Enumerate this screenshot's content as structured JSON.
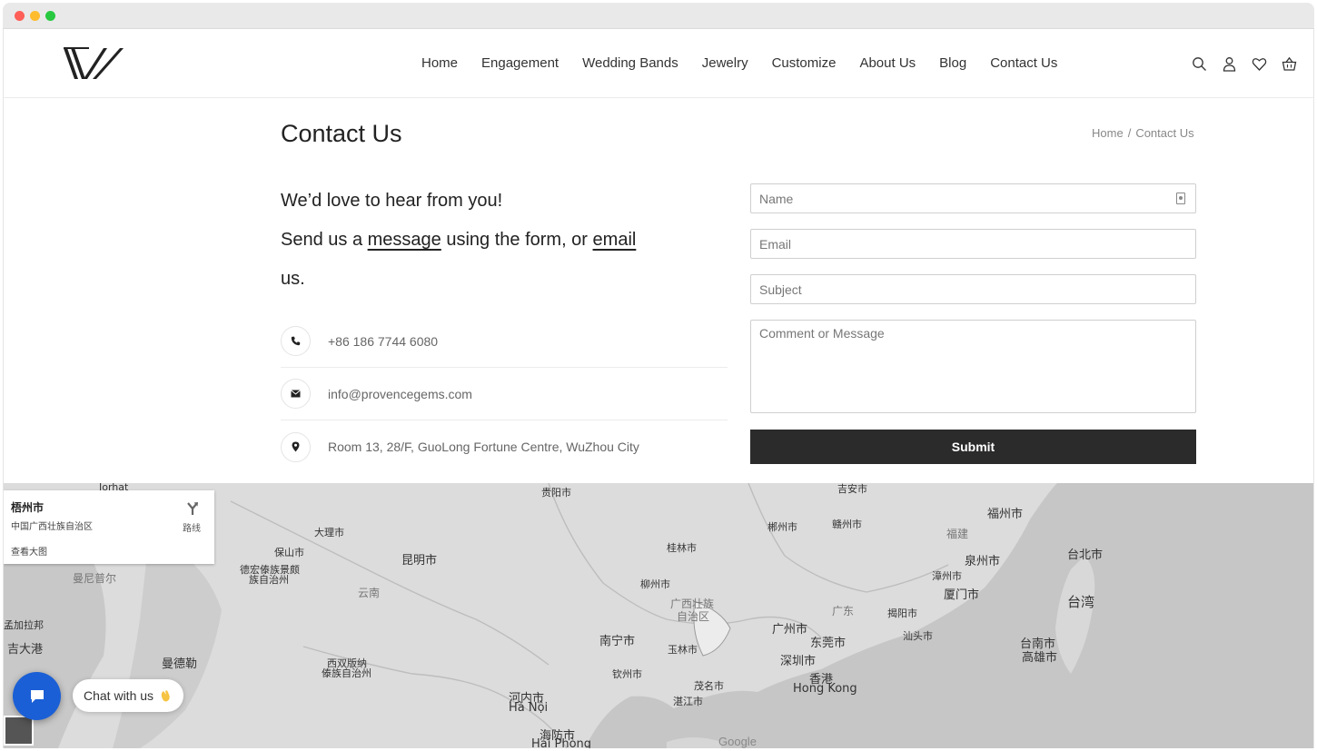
{
  "nav": {
    "items": [
      "Home",
      "Engagement",
      "Wedding Bands",
      "Jewelry",
      "Customize",
      "About Us",
      "Blog",
      "Contact Us"
    ]
  },
  "header_icons": [
    "search-icon",
    "user-icon",
    "heart-icon",
    "basket-icon"
  ],
  "page": {
    "title": "Contact Us",
    "breadcrumb": {
      "home": "Home",
      "sep": "/",
      "current": "Contact Us"
    }
  },
  "intro": {
    "line1": "We’d love to hear from you!",
    "line2_pre": "Send us a ",
    "line2_link1": "message",
    "line2_mid": " using the form, or ",
    "line2_link2": "email",
    "line3": "us."
  },
  "contact_info": {
    "phone": "+86 186 7744 6080",
    "email": "info@provencegems.com",
    "address": "Room 13, 28/F, GuoLong Fortune Centre, WuZhou City"
  },
  "form": {
    "name_placeholder": "Name",
    "email_placeholder": "Email",
    "subject_placeholder": "Subject",
    "message_placeholder": "Comment or Message",
    "submit_label": "Submit"
  },
  "map": {
    "card_title": "梧州市",
    "card_subtitle": "中国广西壮族自治区",
    "card_link": "查看大图",
    "directions_label": "路线",
    "labels": {
      "jorhat": "Jorhat",
      "guiyang": "贵阳市",
      "jian": "吉安市",
      "fuzhou": "福州市",
      "dali": "大理市",
      "baoshan": "保山市",
      "kunming": "昆明市",
      "dehong1": "德宏傣族景颇",
      "dehong2": "族自治州",
      "guilin": "桂林市",
      "chenzhou": "郴州市",
      "ganzhou": "赣州市",
      "fujian": "福建",
      "quanzhou": "泉州市",
      "taibei": "台北市",
      "yunnan": "云南",
      "liuzhou": "柳州市",
      "guangxi1": "广西壮族",
      "guangxi2": "自治区",
      "guangdong": "广东",
      "zhangzhou": "漳州市",
      "xiamen": "厦门市",
      "taiwan": "台湾",
      "jieyang": "揭阳市",
      "shantou": "汕头市",
      "guangzhou": "广州市",
      "dongguan": "东莞市",
      "nanning": "南宁市",
      "yulin": "玉林市",
      "shenzhen": "深圳市",
      "tainan": "台南市",
      "kaohsiung": "高雄市",
      "xiangang": "香港",
      "hongkong": "Hong Kong",
      "xishuang1": "西双版纳",
      "xishuang2": "傣族自治州",
      "qinzhou": "钦州市",
      "maoming": "茂名市",
      "mandalay": "曼德勒",
      "zhanjiang": "湛江市",
      "hanoi_cn": "河内市",
      "hanoi": "Hà Nội",
      "haiphong_cn": "海防市",
      "haiphong": "Hải Phòng",
      "chittagong": "吉大港",
      "bangla": "孟加拉邦",
      "manipur": "曼尼普尔"
    },
    "attribution": "Google"
  },
  "chat": {
    "label": "Chat with us"
  },
  "colors": {
    "submit_bg": "#2b2b2b",
    "chat_blue": "#1a5fd6"
  }
}
